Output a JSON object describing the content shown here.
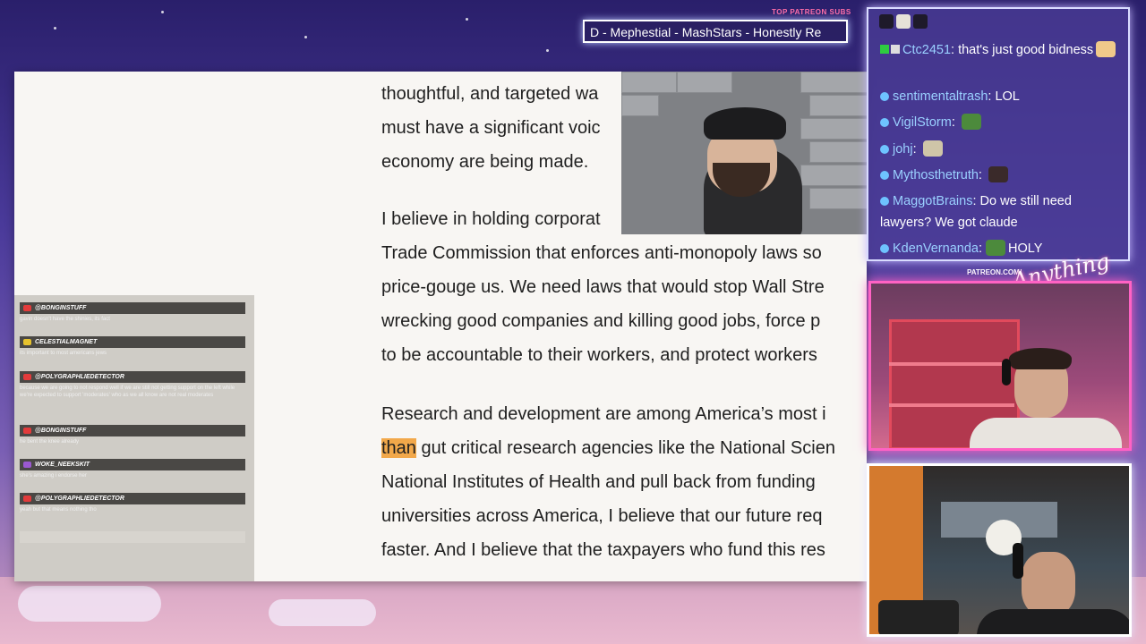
{
  "ticker": {
    "label": "TOP PATREON SUBS",
    "text": "D - Mephestial - MashStars - Honestly Re"
  },
  "article": {
    "lines": [
      "thoughtful, and targeted wa",
      "must have a significant voic",
      "economy are being made.",
      "I believe in holding corporat",
      "Trade Commission that enforces anti-monopoly laws so",
      "price-gouge us. We need laws that would stop Wall Stre",
      "wrecking good companies and killing good jobs, force p",
      "to be accountable to their workers, and protect workers",
      "Research and development are among America’s most i",
      "than",
      "gut critical research agencies like the National Scien",
      "National Institutes of Health and pull back from funding",
      "universities across America, I believe that our future req",
      "faster. And I believe that the taxpayers who fund this res"
    ]
  },
  "side_chat": {
    "entries": [
      {
        "user": "@BONGINSTUFF",
        "badge_color": "#e23b3b",
        "text": "gavin doesn't have the shinies, its fact"
      },
      {
        "user": "CELESTIALMAGNET",
        "badge_color": "#e6c22d",
        "text": "its important to most americans jews"
      },
      {
        "user": "@POLYGRAPHLIEDETECTOR",
        "badge_color": "#e23b3b",
        "text": "because we are going to not respond well if we are still not getting support on the left while we're expected to support 'moderates' who as we all know are not real moderates"
      },
      {
        "user": "@BONGINSTUFF",
        "badge_color": "#e23b3b",
        "text": "he bent the knee already"
      },
      {
        "user": "WOKE_NEEKSKIT",
        "badge_color": "#9b59d0",
        "text": "she's amazing i endorse her"
      },
      {
        "user": "@POLYGRAPHLIEDETECTOR",
        "badge_color": "#e23b3b",
        "text": "yeah but that means nothing tho"
      }
    ]
  },
  "twitch_chat": {
    "messages": [
      {
        "user": "Ctc2451",
        "sep": ": ",
        "text": "that's just good bidness"
      },
      {
        "user": "sentimentaltrash",
        "sep": ": ",
        "text": "LOL"
      },
      {
        "user": "VigilStorm",
        "sep": ": ",
        "text": ""
      },
      {
        "user": "johj",
        "sep": ": ",
        "text": ""
      },
      {
        "user": "Mythosthetruth",
        "sep": ": ",
        "text": ""
      },
      {
        "user": "MaggotBrains",
        "sep": ": ",
        "text": "Do we still need lawyers? We got claude"
      },
      {
        "user": "KdenVernanda",
        "sep": ": ",
        "text": "HOLY"
      }
    ]
  },
  "branding": {
    "patreon_url": "PATREON.COM/",
    "logo_text": "Anything"
  },
  "colors": {
    "highlight": "#f2a84a",
    "guest_border": "#ff62c4",
    "username": "#9ad0ff"
  }
}
